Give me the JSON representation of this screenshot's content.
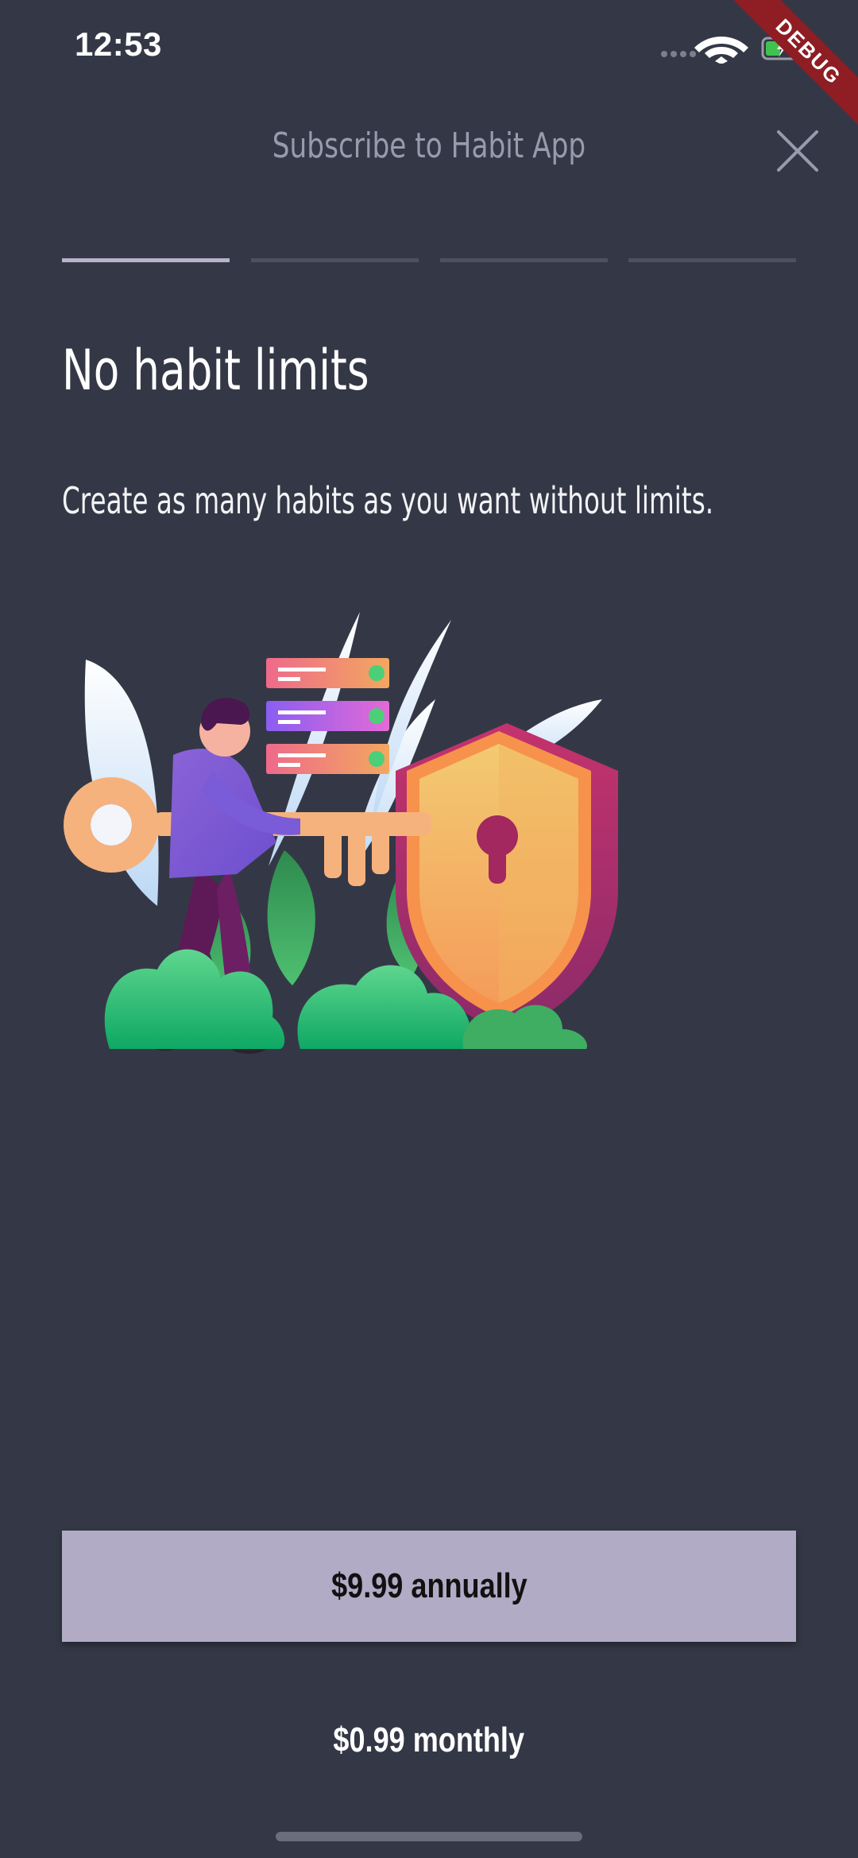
{
  "status_bar": {
    "time": "12:53",
    "icons": [
      "cellular-signal-icon",
      "wifi-icon",
      "battery-charging-icon"
    ]
  },
  "debug_banner": {
    "label": "DEBUG"
  },
  "header": {
    "title": "Subscribe to Habit App",
    "close_icon": "close-icon"
  },
  "progress": {
    "total_steps": 4,
    "current_step": 1
  },
  "content": {
    "headline": "No habit limits",
    "description": "Create as many habits as you want without limits."
  },
  "illustration": {
    "icon": "person-key-shield-illustration"
  },
  "pricing": {
    "annual_label": "$9.99 annually",
    "monthly_label": "$0.99 monthly"
  },
  "colors": {
    "background": "#343846",
    "primary_button": "#b1abc5",
    "progress_active": "#b8b2cc",
    "progress_inactive": "#4c5060",
    "debug_ribbon": "#8e1d24"
  }
}
